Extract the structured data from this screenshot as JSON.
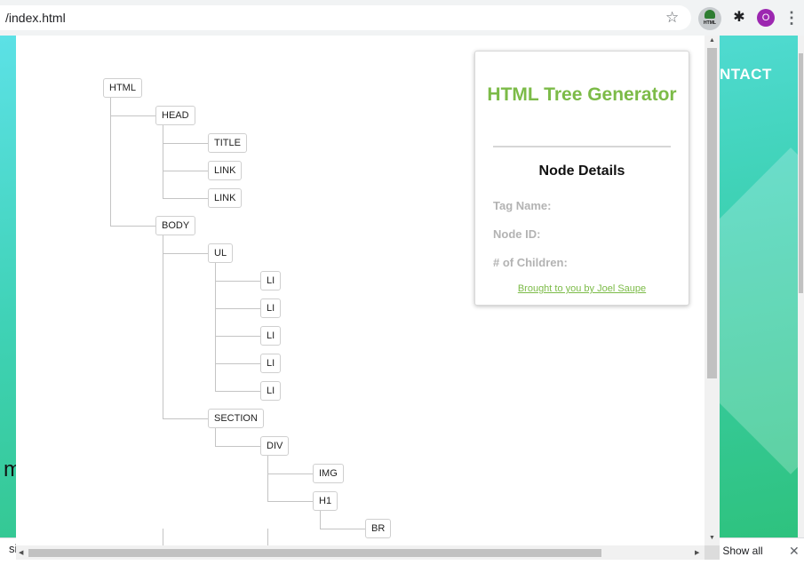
{
  "browser": {
    "url_text": "/index.html",
    "extension_label": "HTML",
    "profile_initial": "O"
  },
  "background_page": {
    "nav_text": "NTACT",
    "partial_text": "m"
  },
  "downloads_bar": {
    "partial_filename": "si",
    "show_all_label": "Show all"
  },
  "tree": [
    {
      "id": "n-html",
      "tag": "HTML",
      "level": 0
    },
    {
      "id": "n-head",
      "tag": "HEAD",
      "level": 1
    },
    {
      "id": "n-title",
      "tag": "TITLE",
      "level": 2
    },
    {
      "id": "n-link1",
      "tag": "LINK",
      "level": 2
    },
    {
      "id": "n-link2",
      "tag": "LINK",
      "level": 2
    },
    {
      "id": "n-body",
      "tag": "BODY",
      "level": 1
    },
    {
      "id": "n-ul",
      "tag": "UL",
      "level": 2
    },
    {
      "id": "n-li1",
      "tag": "LI",
      "level": 3
    },
    {
      "id": "n-li2",
      "tag": "LI",
      "level": 3
    },
    {
      "id": "n-li3",
      "tag": "LI",
      "level": 3
    },
    {
      "id": "n-li4",
      "tag": "LI",
      "level": 3
    },
    {
      "id": "n-li5",
      "tag": "LI",
      "level": 3
    },
    {
      "id": "n-section",
      "tag": "SECTION",
      "level": 2
    },
    {
      "id": "n-div",
      "tag": "DIV",
      "level": 3
    },
    {
      "id": "n-img",
      "tag": "IMG",
      "level": 4
    },
    {
      "id": "n-h1",
      "tag": "H1",
      "level": 4
    },
    {
      "id": "n-br",
      "tag": "BR",
      "level": 5
    }
  ],
  "panel": {
    "title": "HTML Tree Generator",
    "subtitle": "Node Details",
    "fields": [
      "Tag Name:",
      "Node ID:",
      "# of Children:"
    ],
    "credit_link": "Brought to you by Joel Saupe",
    "accent_color": "#7cbb48"
  }
}
